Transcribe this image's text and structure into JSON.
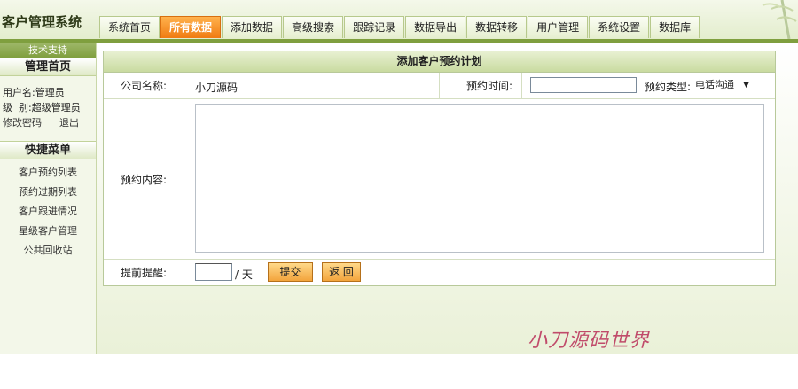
{
  "header": {
    "app_title": "客户管理系统",
    "tabs": [
      {
        "label": "系统首页",
        "active": false
      },
      {
        "label": "所有数据",
        "active": true
      },
      {
        "label": "添加数据",
        "active": false
      },
      {
        "label": "高级搜索",
        "active": false
      },
      {
        "label": "跟踪记录",
        "active": false
      },
      {
        "label": "数据导出",
        "active": false
      },
      {
        "label": "数据转移",
        "active": false
      },
      {
        "label": "用户管理",
        "active": false
      },
      {
        "label": "系统设置",
        "active": false
      },
      {
        "label": "数据库",
        "active": false
      }
    ]
  },
  "sidebar": {
    "tech_support": "技术支持",
    "home_title": "管理首页",
    "user_label": "用户名:",
    "user_name": "管理员",
    "level_label": "级  别:",
    "level_value": "超级管理员",
    "change_password": "修改密码",
    "logout": "退出",
    "shortcut_title": "快捷菜单",
    "shortcuts": [
      "客户预约列表",
      "预约过期列表",
      "客户跟进情况",
      "星级客户管理",
      "公共回收站"
    ]
  },
  "panel": {
    "title": "添加客户预约计划",
    "company_label": "公司名称:",
    "company_value": "小刀源码",
    "time_label": "预约时间:",
    "time_value": "",
    "type_label": "预约类型:",
    "type_selected": "电话沟通",
    "content_label": "预约内容:",
    "content_value": "",
    "remind_label": "提前提醒:",
    "remind_days_value": "",
    "remind_unit": "/ 天",
    "submit_label": "提交",
    "back_label": "返 回"
  },
  "watermark": "小刀源码世界",
  "colors": {
    "accent_orange": "#f07b12",
    "header_green": "#7f9f3e",
    "panel_title_bg": "#c9dba0",
    "watermark": "#c04b6a"
  }
}
